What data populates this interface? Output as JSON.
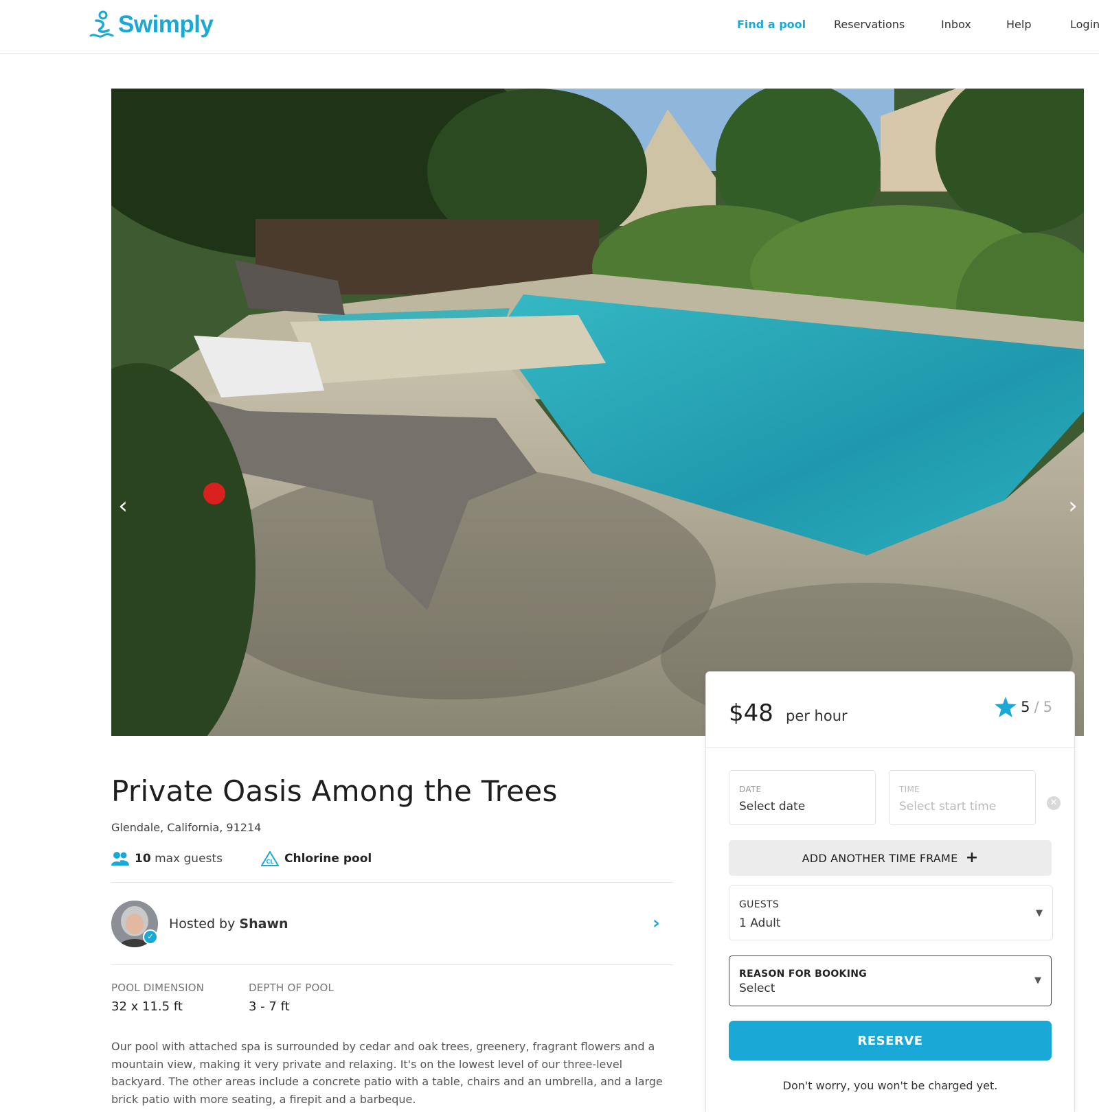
{
  "header": {
    "logo_text": "Swimply",
    "nav": [
      {
        "label": "Find a pool",
        "active": true
      },
      {
        "label": "Reservations"
      },
      {
        "label": "Inbox"
      },
      {
        "label": "Help"
      },
      {
        "label": "Login"
      }
    ]
  },
  "listing": {
    "title": "Private Oasis Among the Trees",
    "address": "Glendale, California, 91214",
    "features": {
      "guests_count": "10",
      "guests_label": "max guests",
      "pool_type": "Chlorine pool",
      "pool_icon_text": "CL"
    },
    "host": {
      "prefix": "Hosted by",
      "name": "Shawn"
    },
    "specs": {
      "dimension_label": "POOL DIMENSION",
      "dimension_value": "32 x 11.5 ft",
      "depth_label": "DEPTH OF POOL",
      "depth_value": "3 - 7 ft"
    },
    "description": "Our pool with attached spa is surrounded by cedar and oak trees, greenery, fragrant flowers and a mountain view, making it very private and relaxing. It's on the lowest level of our three-level backyard. The other areas include a concrete patio with a table, chairs and an umbrella, and a large brick patio with more seating, a firepit and a barbeque."
  },
  "booking": {
    "price": "$48",
    "per": "per hour",
    "rating": "5",
    "rating_sep": "/",
    "rating_max": "5",
    "date_label": "DATE",
    "date_value": "Select date",
    "time_label": "TIME",
    "time_value": "Select start time",
    "add_time": "ADD ANOTHER TIME FRAME",
    "guests_label": "GUESTS",
    "guests_value": "1 Adult",
    "reason_label": "REASON FOR BOOKING",
    "reason_value": "Select",
    "reserve": "RESERVE",
    "note": "Don't worry, you won't be charged yet."
  },
  "colors": {
    "brand": "#1aa9d6"
  }
}
